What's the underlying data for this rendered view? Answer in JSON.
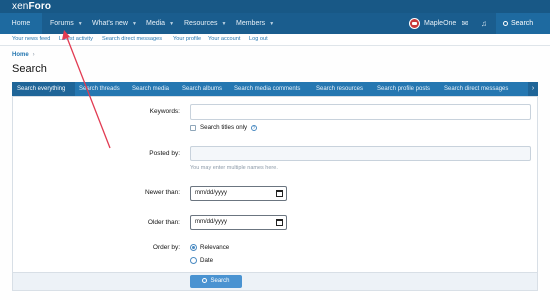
{
  "brand": {
    "logo_thin": "xen",
    "logo_bold": "Foro"
  },
  "nav": {
    "items": [
      {
        "label": "Home"
      },
      {
        "label": "Forums"
      },
      {
        "label": "What's new"
      },
      {
        "label": "Media"
      },
      {
        "label": "Resources"
      },
      {
        "label": "Members"
      }
    ],
    "user": "MapleOne",
    "search_label": "Search"
  },
  "subnav": [
    "Your news feed",
    "Latest activity",
    "Search direct messages",
    "Your profile",
    "Your account",
    "Log out"
  ],
  "breadcrumb": {
    "home": "Home"
  },
  "page_title": "Search",
  "tabs": [
    {
      "label": "Search everything"
    },
    {
      "label": "Search threads"
    },
    {
      "label": "Search media"
    },
    {
      "label": "Search albums"
    },
    {
      "label": "Search media comments"
    },
    {
      "label": "Search resources"
    },
    {
      "label": "Search profile posts"
    },
    {
      "label": "Search direct messages"
    }
  ],
  "form": {
    "keywords_label": "Keywords:",
    "keywords_value": "",
    "titles_only_label": "Search titles only",
    "posted_by_label": "Posted by:",
    "posted_by_value": "",
    "posted_by_hint": "You may enter multiple names here.",
    "newer_than_label": "Newer than:",
    "newer_than_value": "mm/dd/yyyy",
    "older_than_label": "Older than:",
    "older_than_value": "mm/dd/yyyy",
    "order_by_label": "Order by:",
    "order_options": [
      "Relevance",
      "Date"
    ],
    "submit_label": "Search"
  }
}
